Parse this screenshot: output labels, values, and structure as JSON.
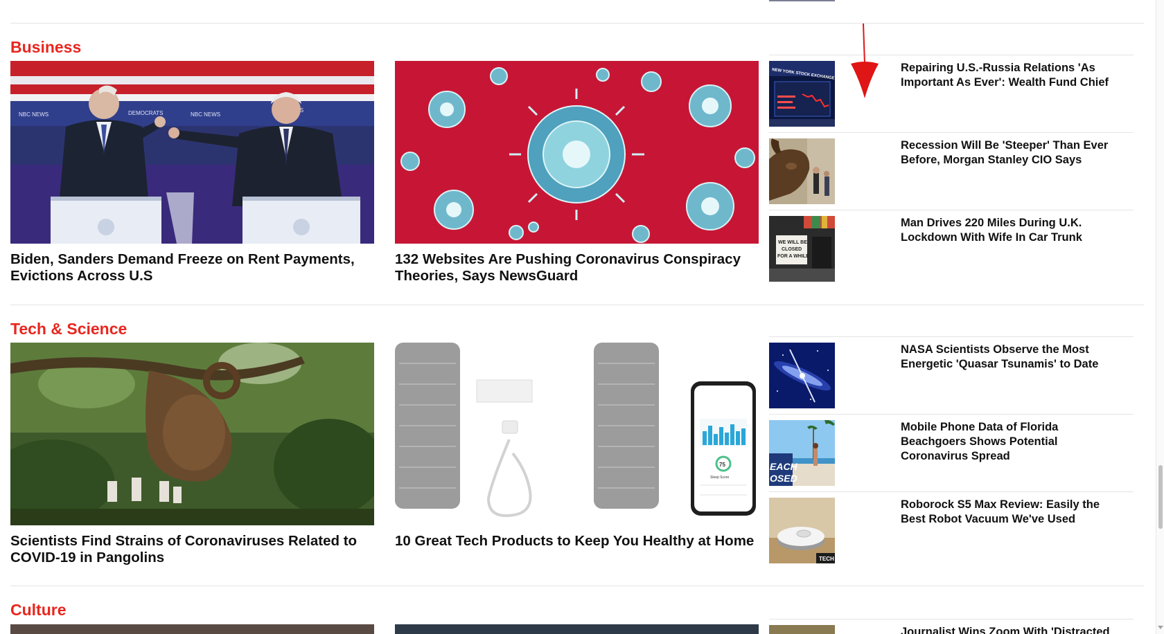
{
  "sections": {
    "business": {
      "title": "Business",
      "features": [
        {
          "headline": "Biden, Sanders Demand Freeze on Rent Payments, Evictions Across U.S"
        },
        {
          "headline": "132 Websites Are Pushing Coronavirus Conspiracy Theories, Says NewsGuard"
        }
      ],
      "side": [
        {
          "title": "Repairing U.S.-Russia Relations 'As Important As Ever': Wealth Fund Chief"
        },
        {
          "title": "Recession Will Be 'Steeper' Than Ever Before, Morgan Stanley CIO Says"
        },
        {
          "title": "Man Drives 220 Miles During U.K. Lockdown With Wife In Car Trunk"
        }
      ]
    },
    "tech": {
      "title": "Tech & Science",
      "features": [
        {
          "headline": "Scientists Find Strains of Coronaviruses Related to COVID-19 in Pangolins"
        },
        {
          "headline": "10 Great Tech Products to Keep You Healthy at Home"
        }
      ],
      "side": [
        {
          "title": "NASA Scientists Observe the Most Energetic 'Quasar Tsunamis' to Date"
        },
        {
          "title": "Mobile Phone Data of Florida Beachgoers Shows Potential Coronavirus Spread"
        },
        {
          "title": "Roborock S5 Max Review: Easily the Best Robot Vacuum We've Used"
        }
      ]
    },
    "culture": {
      "title": "Culture",
      "side": [
        {
          "title": "Journalist Wins Zoom With 'Distracted"
        }
      ]
    }
  },
  "thumb_text": {
    "nyse": "NEW YORK STOCK EXCHANGE",
    "closed_sign": [
      "WE WILL BE",
      "CLOSED",
      "FOR A WHILE"
    ],
    "beach_sign": [
      "EACH",
      "OSED"
    ],
    "tech_badge": "TECH",
    "debate_logos": [
      "NBC NEWS",
      "DEMOCRATS"
    ],
    "app_score_label": "Sleep Score",
    "app_score_value": "75"
  },
  "colors": {
    "section_title": "#e8261e",
    "divider": "#e4e4e4",
    "annotation_arrow": "#e01515"
  },
  "icons": [
    "annotation-arrow-icon",
    "scroll-down-icon"
  ]
}
